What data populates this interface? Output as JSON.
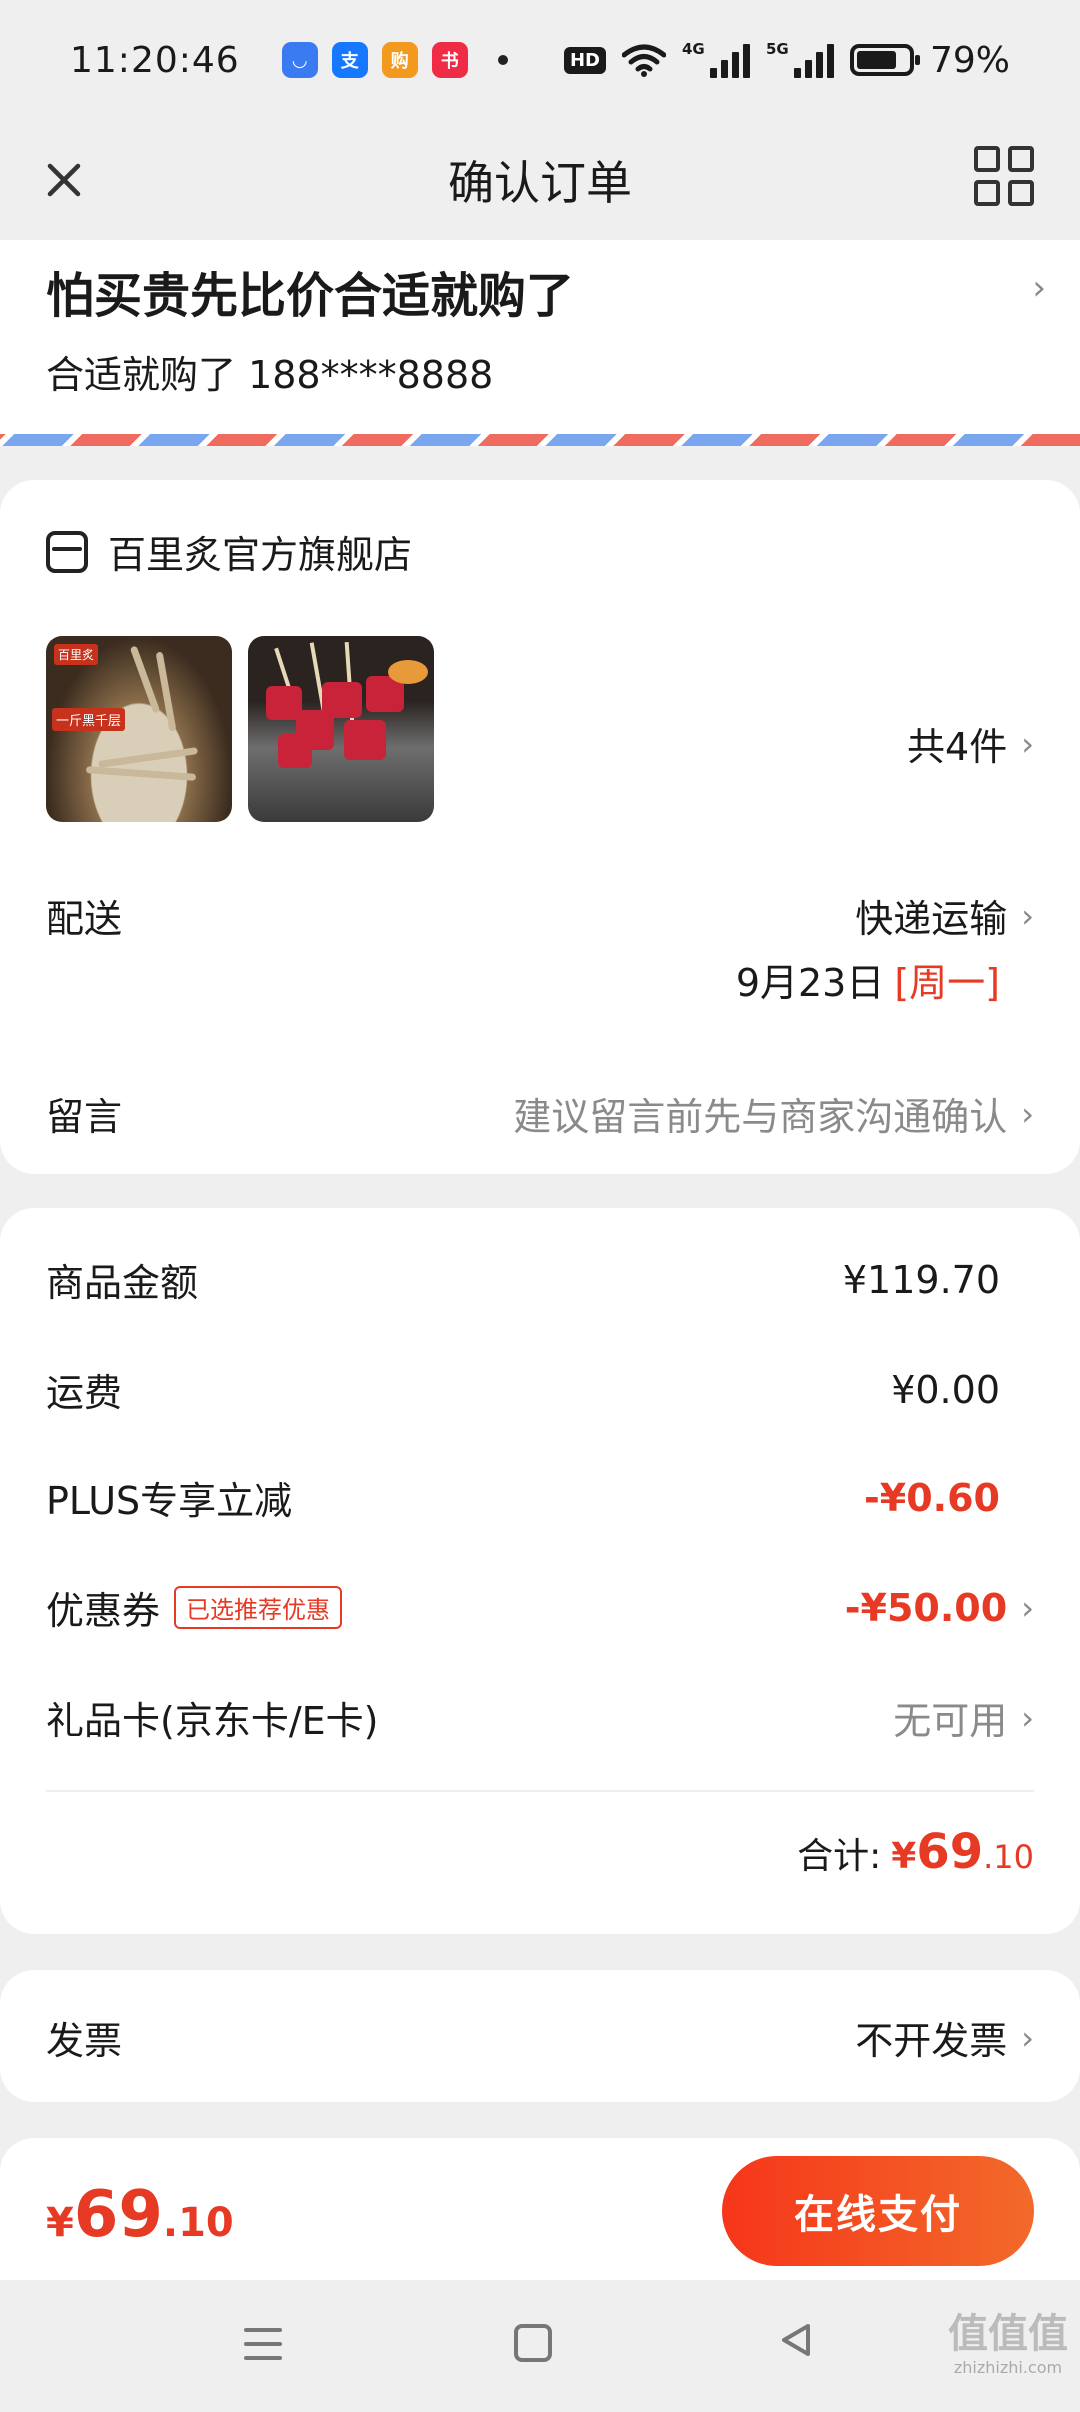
{
  "status_bar": {
    "time": "11:20:46",
    "battery": "79%",
    "network_4g": "4G",
    "network_5g": "5G",
    "hd": "HD"
  },
  "nav": {
    "title": "确认订单"
  },
  "address": {
    "title": "怕买贵先比价合适就购了",
    "contact": "合适就购了 188****8888"
  },
  "order": {
    "store_name": "百里炙官方旗舰店",
    "item_count": "共4件",
    "thumb1_tag": "一斤黑千层",
    "delivery_label": "配送",
    "delivery_method": "快递运输",
    "delivery_date": "9月23日",
    "delivery_weekday": "[周一]",
    "note_label": "留言",
    "note_placeholder": "建议留言前先与商家沟通确认"
  },
  "pricing": {
    "goods_label": "商品金额",
    "goods_value": "¥119.70",
    "shipping_label": "运费",
    "shipping_value": "¥0.00",
    "plus_label": "PLUS专享立减",
    "plus_value": "-¥0.60",
    "coupon_label": "优惠券",
    "coupon_tag": "已选推荐优惠",
    "coupon_value": "-¥50.00",
    "giftcard_label": "礼品卡(京东卡/E卡)",
    "giftcard_value": "无可用",
    "total_label": "合计:",
    "total_symbol": "¥",
    "total_int": "69",
    "total_dec": ".10"
  },
  "invoice": {
    "label": "发票",
    "value": "不开发票"
  },
  "paybar": {
    "symbol": "¥",
    "int": "69",
    "dec": ".10",
    "button": "在线支付"
  },
  "watermark": {
    "text": "值值值",
    "sub": "zhizhizhi.com"
  },
  "colors": {
    "accent": "#e63a24",
    "pay_button_start": "#f6361a",
    "pay_button_end": "#f26a2a"
  }
}
